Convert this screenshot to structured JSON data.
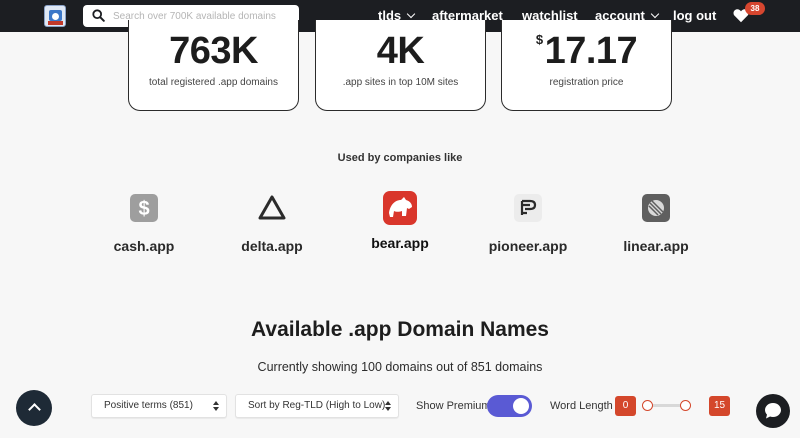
{
  "header": {
    "search_placeholder": "Search over 700K available domains",
    "nav": {
      "tlds": "tlds",
      "aftermarket": "aftermarket",
      "watchlist": "watchlist",
      "account": "account",
      "logout": "log out"
    },
    "favorites_count": "38"
  },
  "stats": [
    {
      "value": "763K",
      "label": "total registered .app domains"
    },
    {
      "value": "4K",
      "label": ".app sites in top 10M sites"
    },
    {
      "currency": "$",
      "value": "17.17",
      "label": "registration price"
    }
  ],
  "used_by": {
    "title": "Used by companies like",
    "companies": [
      {
        "name": "cash.app",
        "icon": "cash-app-icon"
      },
      {
        "name": "delta.app",
        "icon": "delta-app-icon"
      },
      {
        "name": "bear.app",
        "icon": "bear-app-icon"
      },
      {
        "name": "pioneer.app",
        "icon": "pioneer-app-icon"
      },
      {
        "name": "linear.app",
        "icon": "linear-app-icon"
      }
    ]
  },
  "listing": {
    "title": "Available .app Domain Names",
    "subtitle": "Currently showing 100 domains out of 851 domains"
  },
  "filters": {
    "terms_selected": "Positive terms (851)",
    "sort_selected": "Sort by Reg-TLD (High to Low)",
    "show_premium_label": "Show Premium",
    "show_premium_on": true,
    "word_length_label": "Word Length",
    "word_length_min": "0",
    "word_length_max": "15"
  },
  "colors": {
    "accent": "#5a5ad4",
    "badge": "#d6462f",
    "range": "#d4472b",
    "navbar": "#1c1e22"
  }
}
